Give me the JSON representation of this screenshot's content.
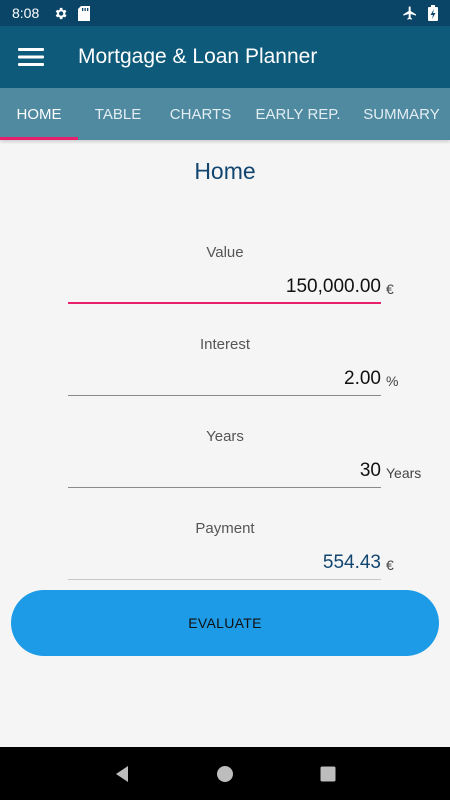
{
  "status_bar": {
    "time": "8:08",
    "icons": [
      "gear-icon",
      "sd-card-icon",
      "airplane-icon",
      "battery-charging-icon"
    ]
  },
  "app_bar": {
    "menu_icon": "hamburger-icon",
    "title": "Mortgage & Loan Planner"
  },
  "tabs": [
    {
      "label": "HOME",
      "active": true
    },
    {
      "label": "TABLE",
      "active": false
    },
    {
      "label": "CHARTS",
      "active": false
    },
    {
      "label": "EARLY REP.",
      "active": false
    },
    {
      "label": "SUMMARY",
      "active": false
    }
  ],
  "page": {
    "title": "Home"
  },
  "fields": {
    "value": {
      "label": "Value",
      "value": "150,000.00",
      "unit": "€"
    },
    "interest": {
      "label": "Interest",
      "value": "2.00",
      "unit": "%"
    },
    "years": {
      "label": "Years",
      "value": "30",
      "unit": "Years"
    },
    "payment": {
      "label": "Payment",
      "value": "554.43",
      "unit": "€"
    }
  },
  "actions": {
    "evaluate_label": "EVALUATE"
  },
  "nav_bar": {
    "icons": [
      "back-icon",
      "home-icon",
      "recents-icon"
    ]
  },
  "colors": {
    "status_bar": "#0a4466",
    "app_bar": "#0e5a7a",
    "tabs_bg": "#4f8aa0",
    "tab_indicator": "#e8206c",
    "title": "#124670",
    "button": "#1e9be6"
  }
}
